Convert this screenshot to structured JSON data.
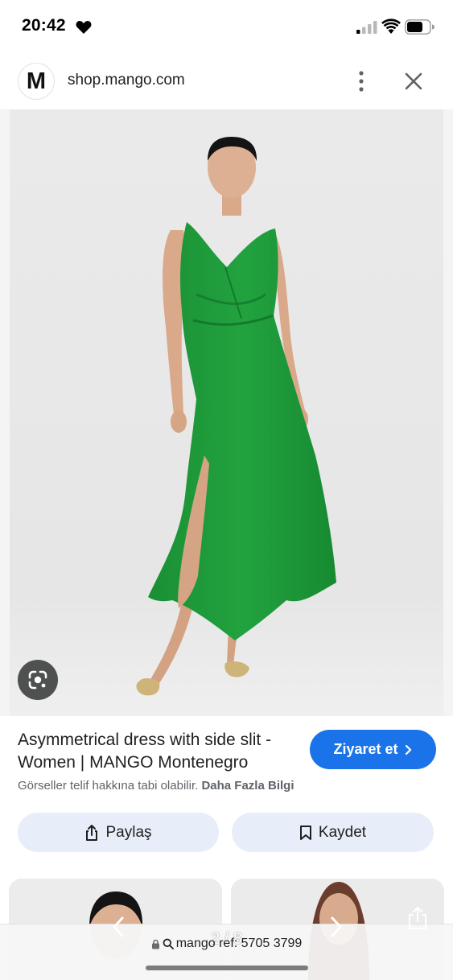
{
  "status_bar": {
    "time": "20:42"
  },
  "browser": {
    "site_logo_letter": "M",
    "url": "shop.mango.com"
  },
  "result": {
    "title": "Asymmetrical dress with side slit - Women | MANGO Montenegro",
    "visit_label": "Ziyaret et",
    "copyright_text": "Görseller telif hakkına tabi olabilir.",
    "more_info_label": "Daha Fazla Bilgi",
    "share_label": "Paylaş",
    "save_label": "Kaydet"
  },
  "bottom": {
    "page_counter": "2 / 8",
    "address": "mango ref: 5705 3799"
  },
  "colors": {
    "accent": "#1a73e8",
    "dress": "#1f9a3a",
    "pill": "#e8eef9"
  },
  "icons": [
    "heart-icon",
    "signal-icon",
    "wifi-icon",
    "battery-icon",
    "more-vert-icon",
    "close-icon",
    "google-lens-icon",
    "chevron-right-icon",
    "share-icon",
    "bookmark-icon",
    "lock-icon",
    "search-icon",
    "chevron-left-icon",
    "ios-share-icon"
  ]
}
